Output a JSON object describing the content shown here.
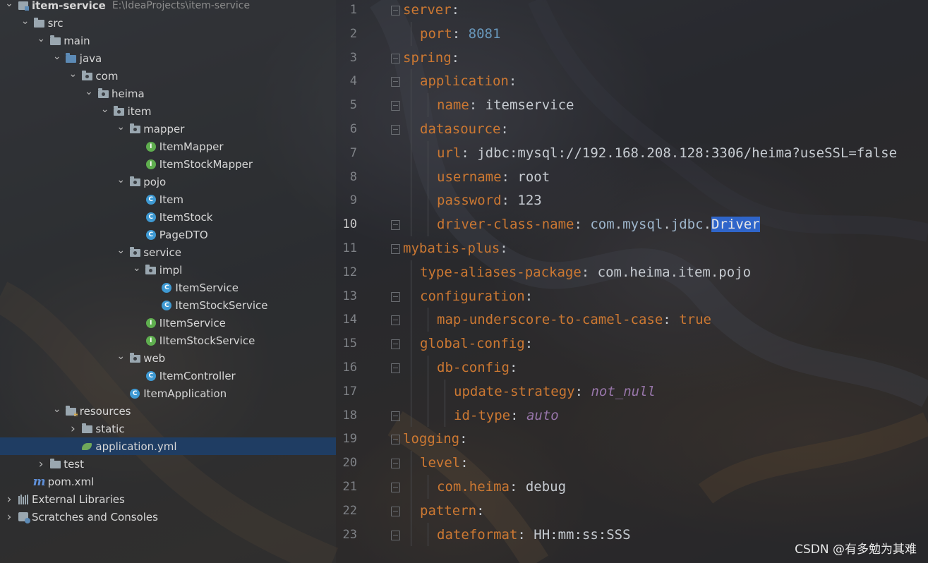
{
  "project_tree": [
    {
      "label": "item-service",
      "path": "E:\\IdeaProjects\\item-service",
      "icon": "module-folder-icon",
      "depth": 0,
      "expanded": true,
      "bold": true
    },
    {
      "label": "src",
      "icon": "folder-icon",
      "depth": 1,
      "expanded": true
    },
    {
      "label": "main",
      "icon": "folder-icon",
      "depth": 2,
      "expanded": true
    },
    {
      "label": "java",
      "icon": "source-folder-icon",
      "depth": 3,
      "expanded": true
    },
    {
      "label": "com",
      "icon": "package-icon",
      "depth": 4,
      "expanded": true
    },
    {
      "label": "heima",
      "icon": "package-icon",
      "depth": 5,
      "expanded": true
    },
    {
      "label": "item",
      "icon": "package-icon",
      "depth": 6,
      "expanded": true
    },
    {
      "label": "mapper",
      "icon": "package-icon",
      "depth": 7,
      "expanded": true
    },
    {
      "label": "ItemMapper",
      "icon": "interface-icon",
      "depth": 8
    },
    {
      "label": "ItemStockMapper",
      "icon": "interface-icon",
      "depth": 8
    },
    {
      "label": "pojo",
      "icon": "package-icon",
      "depth": 7,
      "expanded": true
    },
    {
      "label": "Item",
      "icon": "class-icon",
      "depth": 8
    },
    {
      "label": "ItemStock",
      "icon": "class-icon",
      "depth": 8
    },
    {
      "label": "PageDTO",
      "icon": "class-icon",
      "depth": 8
    },
    {
      "label": "service",
      "icon": "package-icon",
      "depth": 7,
      "expanded": true
    },
    {
      "label": "impl",
      "icon": "package-icon",
      "depth": 8,
      "expanded": true
    },
    {
      "label": "ItemService",
      "icon": "class-icon",
      "depth": 9
    },
    {
      "label": "ItemStockService",
      "icon": "class-icon",
      "depth": 9
    },
    {
      "label": "IItemService",
      "icon": "interface-icon",
      "depth": 8
    },
    {
      "label": "IItemStockService",
      "icon": "interface-icon",
      "depth": 8
    },
    {
      "label": "web",
      "icon": "package-icon",
      "depth": 7,
      "expanded": true
    },
    {
      "label": "ItemController",
      "icon": "class-icon",
      "depth": 8
    },
    {
      "label": "ItemApplication",
      "icon": "spring-boot-class-icon",
      "depth": 7
    },
    {
      "label": "resources",
      "icon": "resources-folder-icon",
      "depth": 3,
      "expanded": true
    },
    {
      "label": "static",
      "icon": "folder-icon",
      "depth": 4,
      "expanded": false
    },
    {
      "label": "application.yml",
      "icon": "yaml-file-icon",
      "depth": 4,
      "selected": true
    },
    {
      "label": "test",
      "icon": "folder-icon",
      "depth": 2,
      "expanded": false
    },
    {
      "label": "pom.xml",
      "icon": "maven-icon",
      "depth": 1
    },
    {
      "label": "External Libraries",
      "icon": "libraries-icon",
      "depth": 0,
      "expanded": false
    },
    {
      "label": "Scratches and Consoles",
      "icon": "scratches-icon",
      "depth": 0,
      "expanded": false
    }
  ],
  "editor": {
    "current_line": 10,
    "lines": [
      {
        "n": "1",
        "indent": 0,
        "parts": [
          {
            "t": "server",
            "c": "k"
          },
          {
            "t": ":",
            "c": "s"
          }
        ],
        "fold": true
      },
      {
        "n": "2",
        "indent": 1,
        "parts": [
          {
            "t": "port",
            "c": "k"
          },
          {
            "t": ": ",
            "c": "s"
          },
          {
            "t": "8081",
            "c": "n"
          }
        ]
      },
      {
        "n": "3",
        "indent": 0,
        "parts": [
          {
            "t": "spring",
            "c": "k"
          },
          {
            "t": ":",
            "c": "s"
          }
        ],
        "fold": true
      },
      {
        "n": "4",
        "indent": 1,
        "parts": [
          {
            "t": "application",
            "c": "k"
          },
          {
            "t": ":",
            "c": "s"
          }
        ],
        "fold": true
      },
      {
        "n": "5",
        "indent": 2,
        "parts": [
          {
            "t": "name",
            "c": "k"
          },
          {
            "t": ": ",
            "c": "s"
          },
          {
            "t": "itemservice",
            "c": "s"
          }
        ],
        "fold": true
      },
      {
        "n": "6",
        "indent": 1,
        "parts": [
          {
            "t": "datasource",
            "c": "k"
          },
          {
            "t": ":",
            "c": "s"
          }
        ],
        "fold": true
      },
      {
        "n": "7",
        "indent": 2,
        "parts": [
          {
            "t": "url",
            "c": "k"
          },
          {
            "t": ": ",
            "c": "s"
          },
          {
            "t": "jdbc:mysql://192.168.208.128:3306/heima?useSSL=false",
            "c": "s"
          }
        ]
      },
      {
        "n": "8",
        "indent": 2,
        "parts": [
          {
            "t": "username",
            "c": "k"
          },
          {
            "t": ": ",
            "c": "s"
          },
          {
            "t": "root",
            "c": "s"
          }
        ]
      },
      {
        "n": "9",
        "indent": 2,
        "parts": [
          {
            "t": "password",
            "c": "k"
          },
          {
            "t": ": ",
            "c": "s"
          },
          {
            "t": "123",
            "c": "s"
          }
        ]
      },
      {
        "n": "10",
        "indent": 2,
        "parts": [
          {
            "t": "driver-class-name",
            "c": "k"
          },
          {
            "t": ": ",
            "c": "s"
          },
          {
            "t": "com",
            "c": "cls"
          },
          {
            "t": ".",
            "c": "s"
          },
          {
            "t": "mysql",
            "c": "cls"
          },
          {
            "t": ".",
            "c": "s"
          },
          {
            "t": "jdbc",
            "c": "cls"
          },
          {
            "t": ".",
            "c": "s"
          },
          {
            "t": "Driver",
            "c": "sel"
          }
        ],
        "fold": true
      },
      {
        "n": "11",
        "indent": 0,
        "parts": [
          {
            "t": "mybatis-plus",
            "c": "k"
          },
          {
            "t": ":",
            "c": "s"
          }
        ],
        "fold": true
      },
      {
        "n": "12",
        "indent": 1,
        "parts": [
          {
            "t": "type-aliases-package",
            "c": "k"
          },
          {
            "t": ": ",
            "c": "s"
          },
          {
            "t": "com.heima.item.pojo",
            "c": "s"
          }
        ]
      },
      {
        "n": "13",
        "indent": 1,
        "parts": [
          {
            "t": "configuration",
            "c": "k"
          },
          {
            "t": ":",
            "c": "s"
          }
        ],
        "fold": true
      },
      {
        "n": "14",
        "indent": 2,
        "parts": [
          {
            "t": "map-underscore-to-camel-case",
            "c": "k"
          },
          {
            "t": ": ",
            "c": "s"
          },
          {
            "t": "true",
            "c": "t"
          }
        ],
        "fold": true
      },
      {
        "n": "15",
        "indent": 1,
        "parts": [
          {
            "t": "global-config",
            "c": "k"
          },
          {
            "t": ":",
            "c": "s"
          }
        ],
        "fold": true
      },
      {
        "n": "16",
        "indent": 2,
        "parts": [
          {
            "t": "db-config",
            "c": "k"
          },
          {
            "t": ":",
            "c": "s"
          }
        ],
        "fold": true
      },
      {
        "n": "17",
        "indent": 3,
        "parts": [
          {
            "t": "update-strategy",
            "c": "k"
          },
          {
            "t": ": ",
            "c": "s"
          },
          {
            "t": "not_null",
            "c": "it"
          }
        ]
      },
      {
        "n": "18",
        "indent": 3,
        "parts": [
          {
            "t": "id-type",
            "c": "k"
          },
          {
            "t": ": ",
            "c": "s"
          },
          {
            "t": "auto",
            "c": "it"
          }
        ],
        "fold": true
      },
      {
        "n": "19",
        "indent": 0,
        "parts": [
          {
            "t": "logging",
            "c": "k"
          },
          {
            "t": ":",
            "c": "s"
          }
        ],
        "fold": true
      },
      {
        "n": "20",
        "indent": 1,
        "parts": [
          {
            "t": "level",
            "c": "k"
          },
          {
            "t": ":",
            "c": "s"
          }
        ],
        "fold": true
      },
      {
        "n": "21",
        "indent": 2,
        "parts": [
          {
            "t": "com.heima",
            "c": "k"
          },
          {
            "t": ": ",
            "c": "s"
          },
          {
            "t": "debug",
            "c": "s"
          }
        ],
        "fold": true
      },
      {
        "n": "22",
        "indent": 1,
        "parts": [
          {
            "t": "pattern",
            "c": "k"
          },
          {
            "t": ":",
            "c": "s"
          }
        ],
        "fold": true
      },
      {
        "n": "23",
        "indent": 2,
        "parts": [
          {
            "t": "dateformat",
            "c": "k"
          },
          {
            "t": ": ",
            "c": "s"
          },
          {
            "t": "HH:mm:ss:SSS",
            "c": "s"
          }
        ],
        "fold": true
      }
    ]
  },
  "watermark": "CSDN @有多勉为其难",
  "colors": {
    "yaml_key": "#cc7832",
    "number": "#6897bb",
    "selection": "#2f65ca",
    "tree_selection": "#1f3d63"
  }
}
